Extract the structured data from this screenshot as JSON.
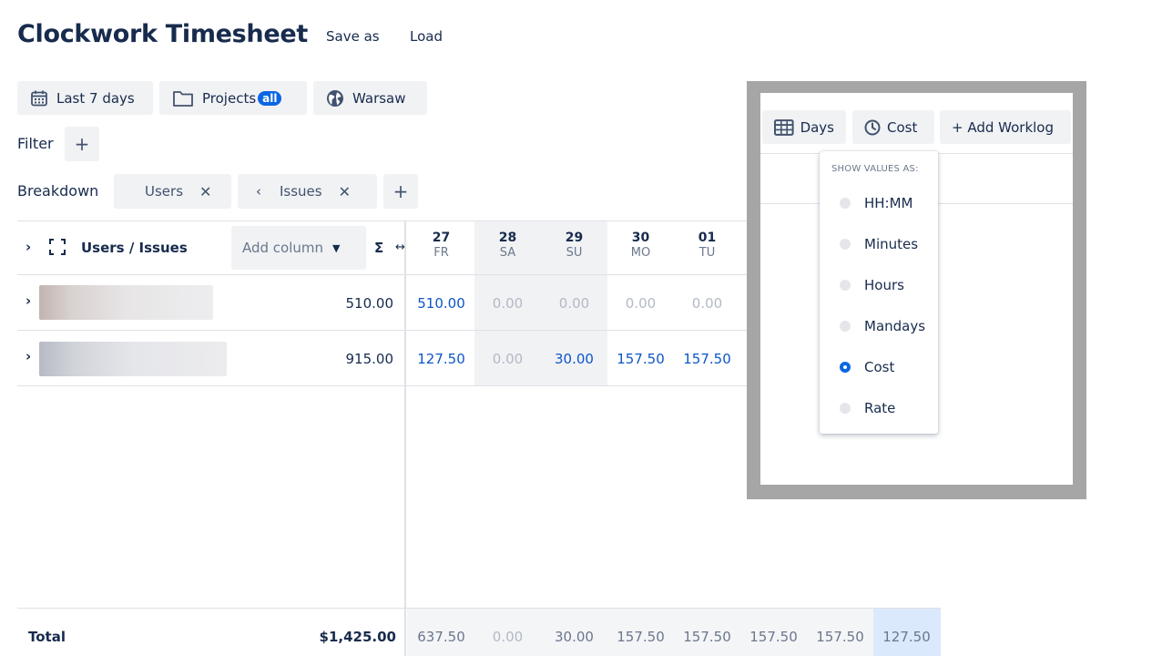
{
  "app": {
    "title": "Clockwork Timesheet",
    "save_as": "Save as",
    "load": "Load"
  },
  "toolbar": {
    "date_range": "Last 7 days",
    "projects": "Projects",
    "projects_badge": "all",
    "timezone": "Warsaw"
  },
  "filter": {
    "label": "Filter",
    "add": "+"
  },
  "breakdown": {
    "label": "Breakdown",
    "chips": [
      {
        "label": "Users",
        "remove": "✕"
      },
      {
        "prefix": "‹",
        "label": "Issues",
        "remove": "✕"
      }
    ],
    "add": "+"
  },
  "table": {
    "group_label": "Users / Issues",
    "add_column": "Add column",
    "sigma": "Σ",
    "resize": "↔",
    "days": [
      {
        "num": "27",
        "name": "FR"
      },
      {
        "num": "28",
        "name": "SA"
      },
      {
        "num": "29",
        "name": "SU"
      },
      {
        "num": "30",
        "name": "MO"
      },
      {
        "num": "01",
        "name": "TU"
      }
    ],
    "rows": [
      {
        "total": "510.00",
        "cells": [
          "510.00",
          "0.00",
          "0.00",
          "0.00",
          "0.00"
        ]
      },
      {
        "total": "915.00",
        "cells": [
          "127.50",
          "0.00",
          "30.00",
          "157.50",
          "157.50"
        ]
      }
    ],
    "footer": {
      "label": "Total",
      "amount": "$1,425.00",
      "cells": [
        "637.50",
        "0.00",
        "30.00",
        "157.50",
        "157.50",
        "157.50",
        "157.50",
        "127.50"
      ]
    }
  },
  "zoom": {
    "days_btn": "Days",
    "cost_btn": "Cost",
    "add_worklog": "+ Add Worklog",
    "dropdown": {
      "heading": "SHOW VALUES AS:",
      "options": [
        {
          "label": "HH:MM",
          "selected": false
        },
        {
          "label": "Minutes",
          "selected": false
        },
        {
          "label": "Hours",
          "selected": false
        },
        {
          "label": "Mandays",
          "selected": false
        },
        {
          "label": "Cost",
          "selected": true
        },
        {
          "label": "Rate",
          "selected": false
        }
      ]
    }
  },
  "colors": {
    "accent": "#0c66e4",
    "link_value": "#0c56c8",
    "weekend_bg": "#f1f2f4",
    "highlight_bg": "#dbe9fd",
    "zoom_frame": "#a6a6a6"
  }
}
